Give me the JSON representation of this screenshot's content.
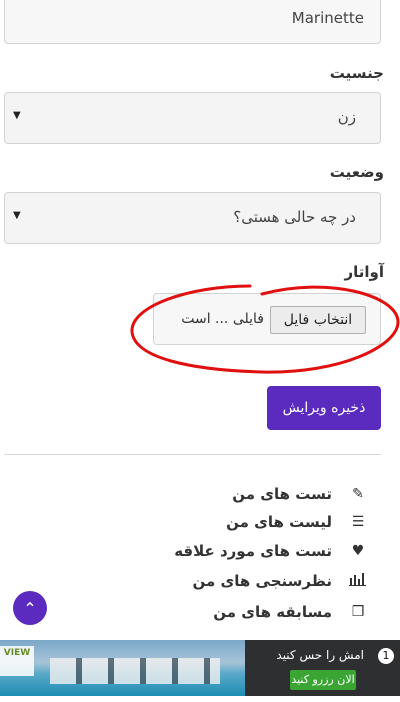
{
  "form": {
    "name_value": "Marinette",
    "gender_label": "جنسیت",
    "gender_value": "زن",
    "status_label": "وضعیت",
    "status_value": "در چه حالی هستی؟",
    "avatar_label": "آواتار",
    "file_button": "انتخاب فایل",
    "file_status": "فایلی ... است",
    "save_label": "ذخیره ویرایش"
  },
  "menu": {
    "items": [
      {
        "label": "تست های من",
        "icon": "pencil-icon"
      },
      {
        "label": "لیست های من",
        "icon": "list-icon"
      },
      {
        "label": "تست های مورد علاقه",
        "icon": "heart-icon"
      },
      {
        "label": "نظرسنجی های من",
        "icon": "bar-chart-icon"
      },
      {
        "label": "مسابقه های من",
        "icon": "cubes-icon"
      }
    ]
  },
  "ad": {
    "logo_text": "VIEW",
    "headline": "امش را حس کنید",
    "cta": "الان رزرو کنید",
    "badge": "1"
  },
  "colors": {
    "accent": "#5b2bbf",
    "annotation": "#e01010"
  }
}
